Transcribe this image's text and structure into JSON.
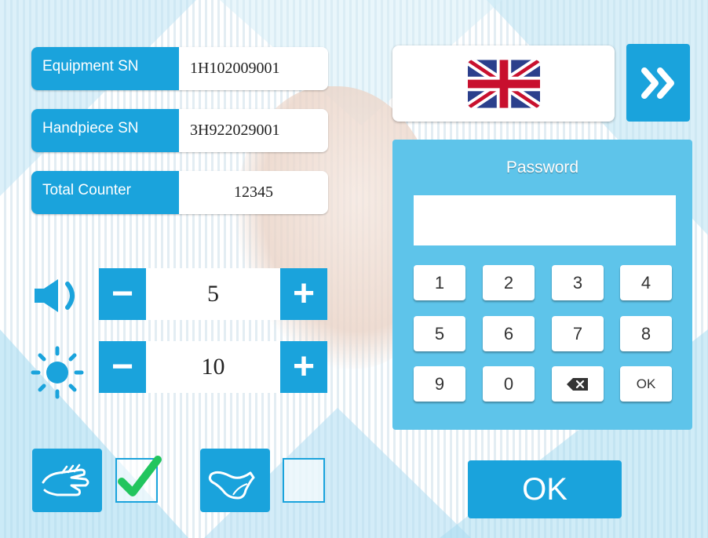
{
  "info": {
    "equipment_sn": {
      "label": "Equipment  SN",
      "value": "1H102009001"
    },
    "handpiece_sn": {
      "label": "Handpiece  SN",
      "value": "3H922029001"
    },
    "total_counter": {
      "label": "Total Counter",
      "value": "12345"
    }
  },
  "volume": {
    "icon": "speaker-icon",
    "minus": "−",
    "value": "5",
    "plus": "+"
  },
  "brightness": {
    "icon": "sun-icon",
    "minus": "−",
    "value": "10",
    "plus": "+"
  },
  "language": {
    "icon": "uk-flag-icon",
    "next_icon": "double-chevron-right-icon"
  },
  "password": {
    "title": "Password",
    "value": "",
    "keys": [
      "1",
      "2",
      "3",
      "4",
      "5",
      "6",
      "7",
      "8",
      "9",
      "0",
      "⌫",
      "OK"
    ]
  },
  "modes": [
    {
      "icon": "hand-icon",
      "checked": true
    },
    {
      "icon": "foot-icon",
      "checked": false
    }
  ],
  "ok_label": "OK",
  "colors": {
    "accent": "#1aa3dc",
    "panel": "#5ec4ea",
    "check": "#22c55e"
  }
}
